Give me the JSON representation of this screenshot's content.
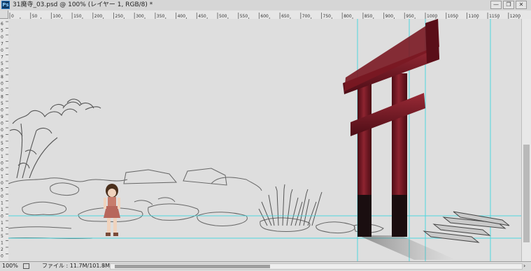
{
  "window": {
    "app_icon_label": "Ps",
    "title": "31廃寺_03.psd @ 100% (レイヤー 1, RGB/8) *",
    "minimize_label": "—",
    "restore_label": "❐",
    "close_label": "✕"
  },
  "ruler_horizontal": [
    "0",
    "50",
    "100",
    "150",
    "200",
    "250",
    "300",
    "350",
    "400",
    "450",
    "500",
    "550",
    "600",
    "650",
    "700",
    "750",
    "800",
    "850",
    "900",
    "950",
    "1000",
    "1050",
    "1100",
    "1150",
    "1200"
  ],
  "ruler_vertical": [
    "6",
    "5",
    "0",
    "7",
    "0",
    "7",
    "5",
    "0",
    "8",
    "0",
    "0",
    "8",
    "5",
    "0",
    "9",
    "0",
    "0",
    "9",
    "5",
    "0",
    "1",
    "0",
    "0",
    "1",
    "0",
    "5",
    "0",
    "1",
    "1",
    "0",
    "1",
    "1",
    "5",
    "1",
    "2",
    "0"
  ],
  "icons": {
    "app": "photoshop-icon",
    "status_document": "document-info-icon",
    "status_arrow": "chevron-right-icon"
  },
  "status": {
    "zoom": "100%",
    "file_info": "ファイル : 11.7M/101.8M",
    "arrow": "›",
    "scroll_right": "›"
  },
  "colors": {
    "canvas_bg": "#dedede",
    "guide": "#34d6de",
    "torii_red": "#7e1a24",
    "torii_black": "#1a0e10"
  }
}
